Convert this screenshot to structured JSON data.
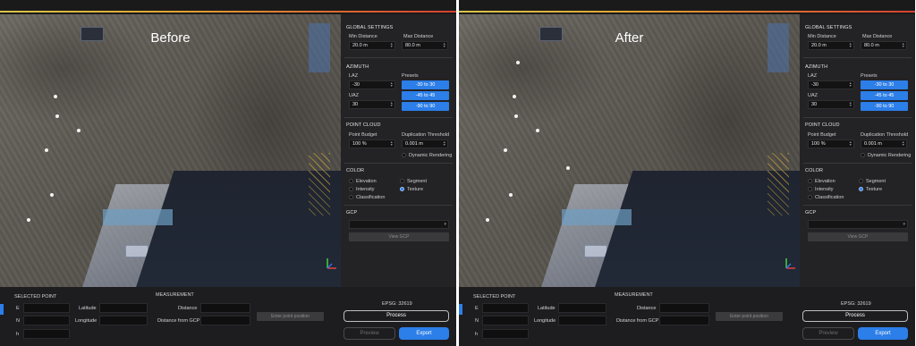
{
  "colors": {
    "accent_blue": "#2c7ee8",
    "panel_bg": "#1d1d1f",
    "top_gradient": [
      "#d9c54a",
      "#e0a133",
      "#d64032"
    ]
  },
  "panels": [
    {
      "title": "Before",
      "global_settings": {
        "title": "GLOBAL SETTINGS",
        "min_distance_label": "Min Distance",
        "min_distance_value": "20.0 m",
        "max_distance_label": "Max Distance",
        "max_distance_value": "80.0 m"
      },
      "azimuth": {
        "title": "AZIMUTH",
        "laz_label": "LAZ",
        "laz_value": "-30",
        "uaz_label": "UAZ",
        "uaz_value": "30",
        "presets_label": "Presets",
        "presets": [
          "-30 to 30",
          "-45 to 45",
          "-90 to 90"
        ]
      },
      "point_cloud": {
        "title": "POINT CLOUD",
        "budget_label": "Point Budget",
        "budget_value": "100 %",
        "dup_label": "Duplication Threshold",
        "dup_value": "0.001 m",
        "dynamic_label": "Dynamic Rendering"
      },
      "color": {
        "title": "COLOR",
        "options": [
          "Elevation",
          "Segment",
          "Intensity",
          "Texture",
          "Classification"
        ],
        "selected": "Texture"
      },
      "gcp": {
        "title": "GCP",
        "select_value": "",
        "view_button": "View GCP"
      },
      "selected_point": {
        "title": "SELECTED POINT",
        "e_label": "E",
        "n_label": "N",
        "h_label": "h",
        "lat_label": "Latitude",
        "lon_label": "Longitude"
      },
      "measurement": {
        "title": "MEASUREMENT",
        "distance_label": "Distance",
        "gcp_distance_label": "Distance from GCP",
        "enter_button": "Enter point position"
      },
      "epsg": "EPSG: 32619",
      "process_button": "Process",
      "preview_button": "Preview",
      "export_button": "Export"
    },
    {
      "title": "After",
      "global_settings": {
        "title": "GLOBAL SETTINGS",
        "min_distance_label": "Min Distance",
        "min_distance_value": "20.0 m",
        "max_distance_label": "Max Distance",
        "max_distance_value": "80.0 m"
      },
      "azimuth": {
        "title": "AZIMUTH",
        "laz_label": "LAZ",
        "laz_value": "-30",
        "uaz_label": "UAZ",
        "uaz_value": "30",
        "presets_label": "Presets",
        "presets": [
          "-30 to 30",
          "-45 to 45",
          "-90 to 90"
        ]
      },
      "point_cloud": {
        "title": "POINT CLOUD",
        "budget_label": "Point Budget",
        "budget_value": "100 %",
        "dup_label": "Duplication Threshold",
        "dup_value": "0.001 m",
        "dynamic_label": "Dynamic Rendering"
      },
      "color": {
        "title": "COLOR",
        "options": [
          "Elevation",
          "Segment",
          "Intensity",
          "Texture",
          "Classification"
        ],
        "selected": "Texture"
      },
      "gcp": {
        "title": "GCP",
        "select_value": "",
        "view_button": "View GCP"
      },
      "selected_point": {
        "title": "SELECTED POINT",
        "e_label": "E",
        "n_label": "N",
        "h_label": "h",
        "lat_label": "Latitude",
        "lon_label": "Longitude"
      },
      "measurement": {
        "title": "MEASUREMENT",
        "distance_label": "Distance",
        "gcp_distance_label": "Distance from GCP",
        "enter_button": "Enter point position"
      },
      "epsg": "EPSG: 32619",
      "process_button": "Process",
      "preview_button": "Preview",
      "export_button": "Export"
    }
  ]
}
